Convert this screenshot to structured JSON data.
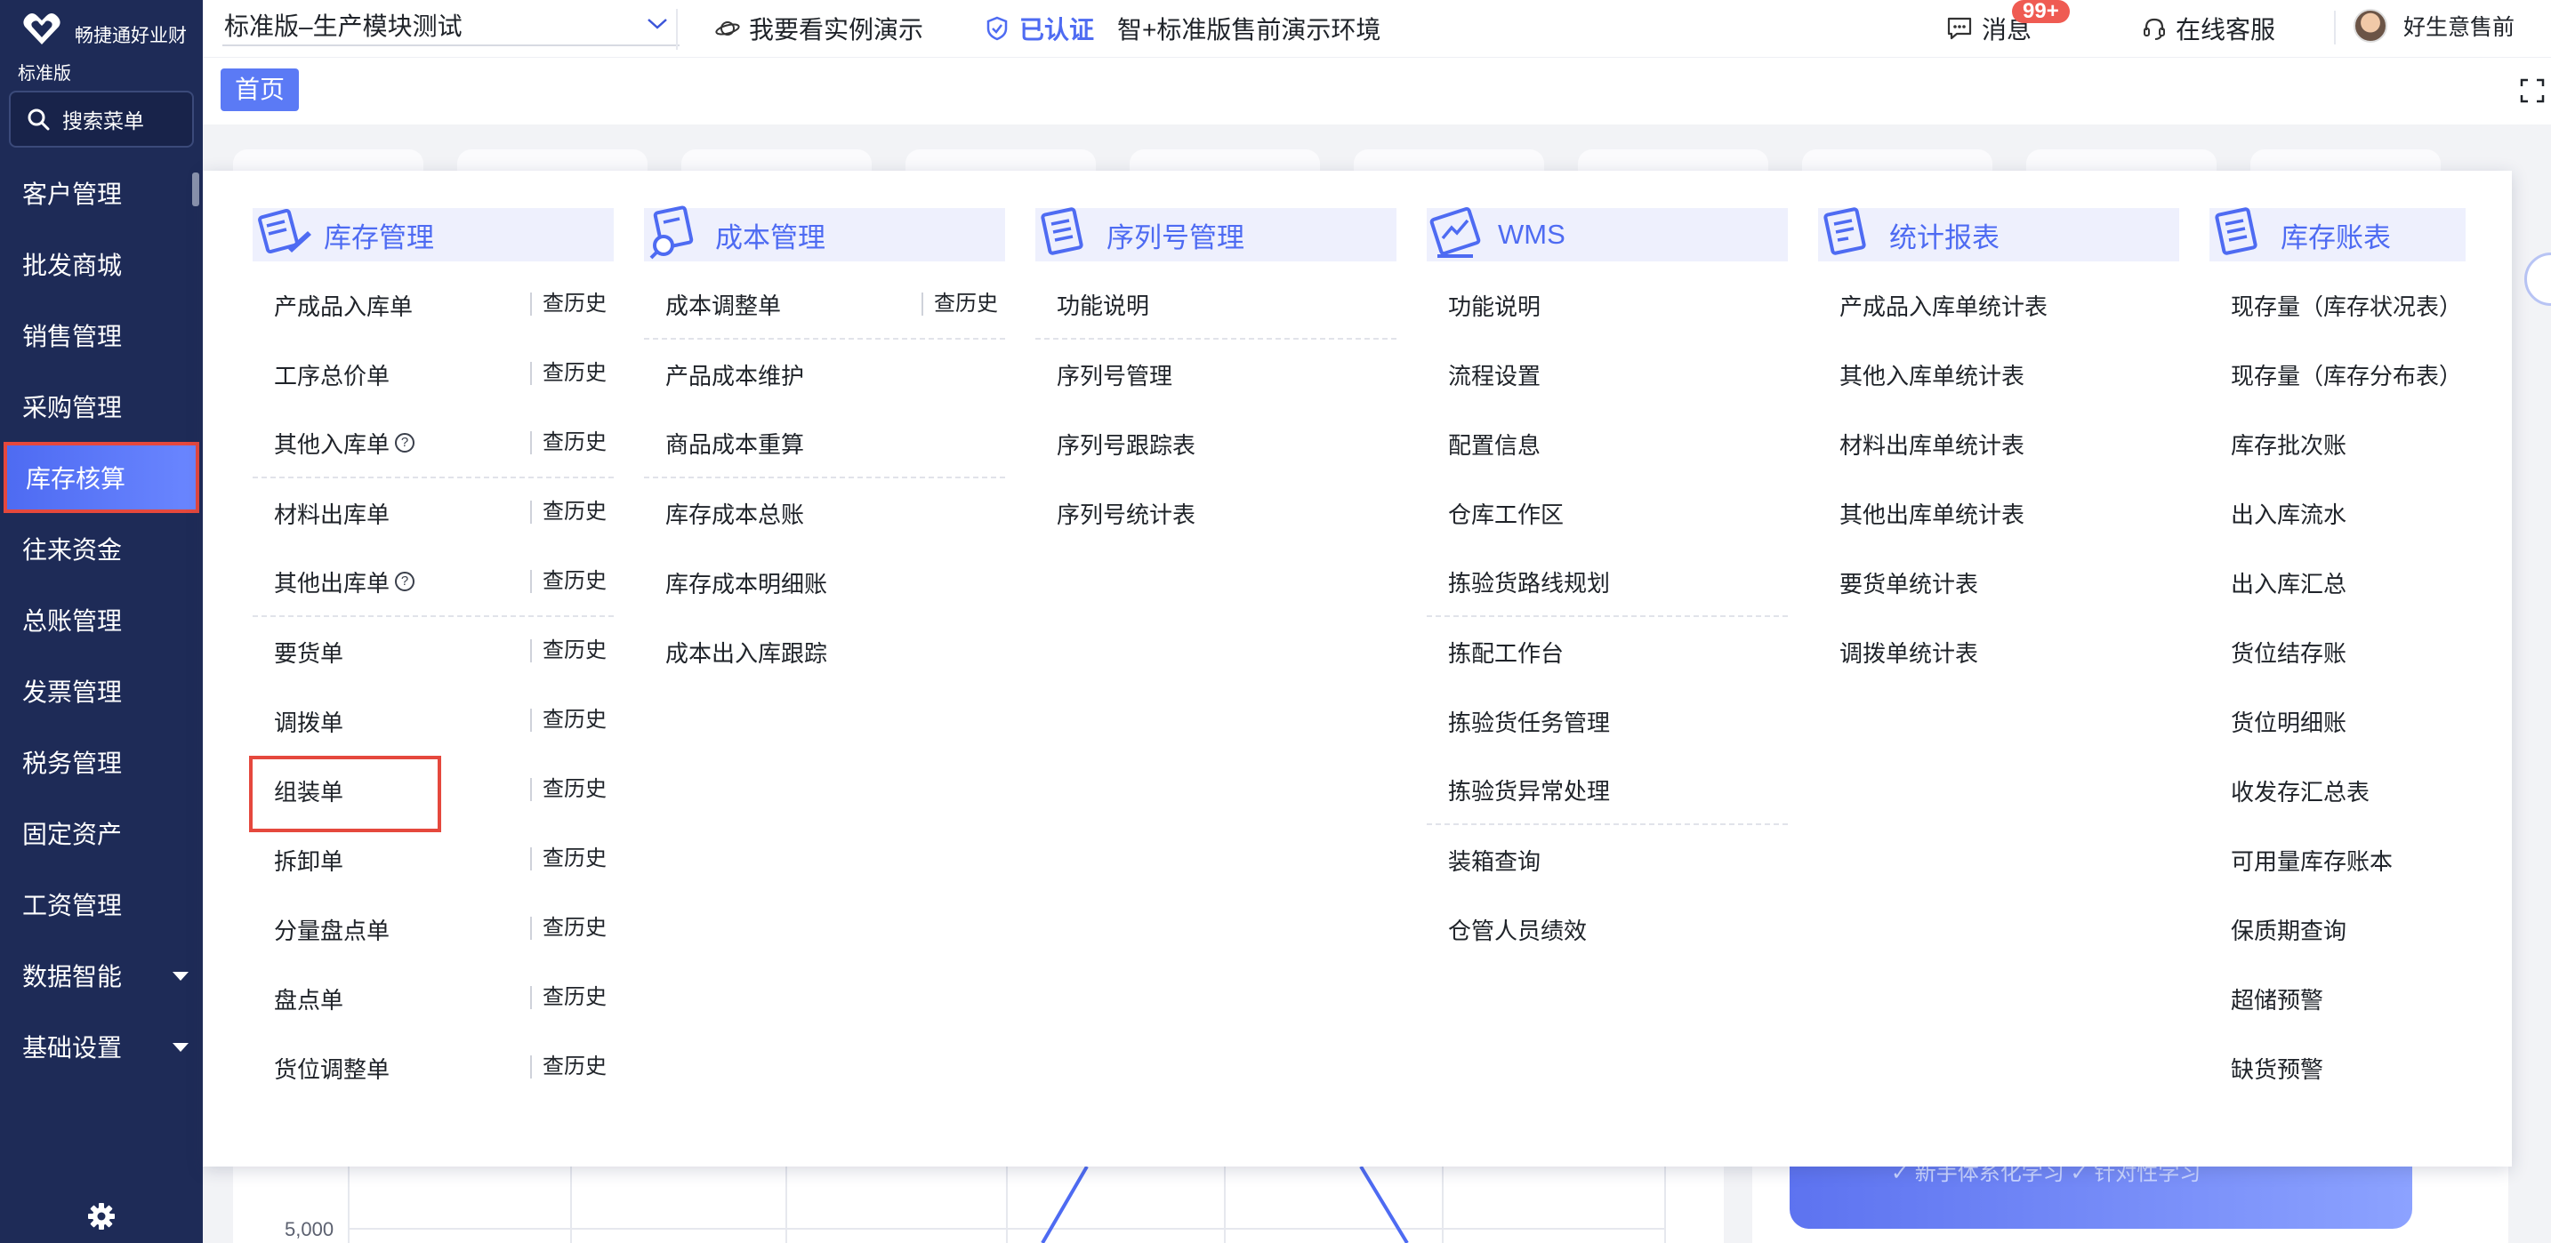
{
  "sidebar": {
    "brand_name": "畅捷通好业财",
    "brand_edition": "标准版",
    "search_label": "搜索菜单",
    "items": [
      {
        "label": "客户管理"
      },
      {
        "label": "批发商城"
      },
      {
        "label": "销售管理"
      },
      {
        "label": "采购管理"
      },
      {
        "label": "库存核算"
      },
      {
        "label": "往来资金"
      },
      {
        "label": "总账管理"
      },
      {
        "label": "发票管理"
      },
      {
        "label": "税务管理"
      },
      {
        "label": "固定资产"
      },
      {
        "label": "工资管理"
      },
      {
        "label": "数据智能"
      },
      {
        "label": "基础设置"
      }
    ],
    "active_item": "库存核算"
  },
  "topbar": {
    "env_select_value": "标准版–生产模块测试",
    "demo_link": "我要看实例演示",
    "certified": "已认证",
    "environment_text": "智+标准版售前演示环境",
    "messages_label": "消息",
    "messages_badge": "99+",
    "service_label": "在线客服",
    "user_name": "好生意售前"
  },
  "tabs": {
    "home": "首页"
  },
  "background": {
    "axis_tick": "5,000",
    "banner_text": "✓ 新手体系化学习   ✓ 针对性学习"
  },
  "mega_menu": {
    "history_label": "查历史",
    "help_glyph": "?",
    "columns": [
      {
        "title": "库存管理",
        "items": [
          {
            "label": "产成品入库单"
          },
          {
            "label": "工序总价单"
          },
          {
            "label": "其他入库单"
          },
          {
            "label": "材料出库单"
          },
          {
            "label": "其他出库单"
          },
          {
            "label": "要货单"
          },
          {
            "label": "调拨单"
          },
          {
            "label": "组装单"
          },
          {
            "label": "拆卸单"
          },
          {
            "label": "分量盘点单"
          },
          {
            "label": "盘点单"
          },
          {
            "label": "货位调整单"
          }
        ]
      },
      {
        "title": "成本管理",
        "items": [
          {
            "label": "成本调整单"
          },
          {
            "label": "产品成本维护"
          },
          {
            "label": "商品成本重算"
          },
          {
            "label": "库存成本总账"
          },
          {
            "label": "库存成本明细账"
          },
          {
            "label": "成本出入库跟踪"
          }
        ]
      },
      {
        "title": "序列号管理",
        "items": [
          {
            "label": "功能说明"
          },
          {
            "label": "序列号管理"
          },
          {
            "label": "序列号跟踪表"
          },
          {
            "label": "序列号统计表"
          }
        ]
      },
      {
        "title": "WMS",
        "items": [
          {
            "label": "功能说明"
          },
          {
            "label": "流程设置"
          },
          {
            "label": "配置信息"
          },
          {
            "label": "仓库工作区"
          },
          {
            "label": "拣验货路线规划"
          },
          {
            "label": "拣配工作台"
          },
          {
            "label": "拣验货任务管理"
          },
          {
            "label": "拣验货异常处理"
          },
          {
            "label": "装箱查询"
          },
          {
            "label": "仓管人员绩效"
          }
        ]
      },
      {
        "title": "统计报表",
        "items": [
          {
            "label": "产成品入库单统计表"
          },
          {
            "label": "其他入库单统计表"
          },
          {
            "label": "材料出库单统计表"
          },
          {
            "label": "其他出库单统计表"
          },
          {
            "label": "要货单统计表"
          },
          {
            "label": "调拨单统计表"
          }
        ]
      },
      {
        "title": "库存账表",
        "items": [
          {
            "label": "现存量（库存状况表）"
          },
          {
            "label": "现存量（库存分布表）"
          },
          {
            "label": "库存批次账"
          },
          {
            "label": "出入库流水"
          },
          {
            "label": "出入库汇总"
          },
          {
            "label": "货位结存账"
          },
          {
            "label": "货位明细账"
          },
          {
            "label": "收发存汇总表"
          },
          {
            "label": "可用量库存账本"
          },
          {
            "label": "保质期查询"
          },
          {
            "label": "超储预警"
          },
          {
            "label": "缺货预警"
          }
        ]
      }
    ]
  },
  "colors": {
    "sidebar_bg": "#1e2b57",
    "accent": "#4e6bf2",
    "highlight_box": "#e5483d",
    "badge": "#ef5b52"
  }
}
